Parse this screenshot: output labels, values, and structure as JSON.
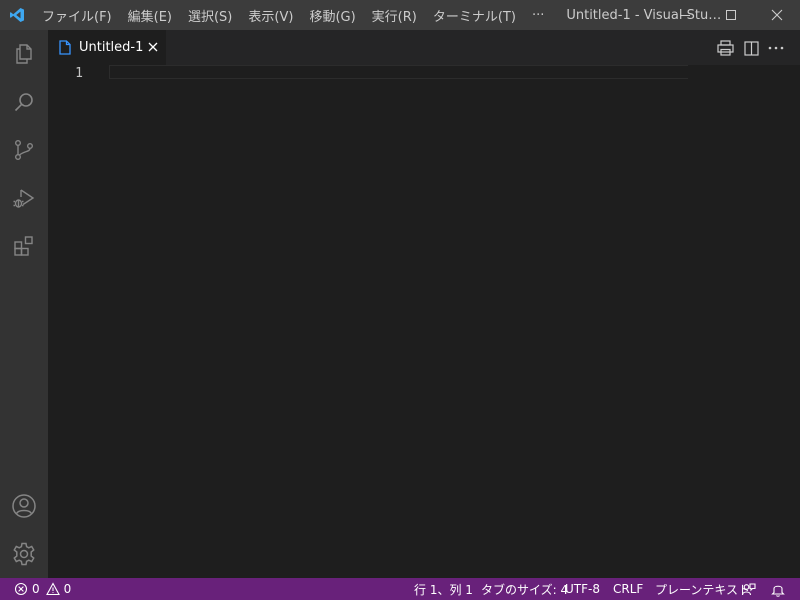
{
  "titlebar": {
    "app_icon": "vscode-logo-icon",
    "menu": [
      "ファイル(F)",
      "編集(E)",
      "選択(S)",
      "表示(V)",
      "移動(G)",
      "実行(R)",
      "ターミナル(T)",
      "···"
    ],
    "window_title": "Untitled-1 - Visual Studio ...",
    "controls": [
      "minimize-icon",
      "maximize-icon",
      "close-icon"
    ]
  },
  "activity_bar": {
    "top": [
      "explorer-icon",
      "search-icon",
      "source-control-icon",
      "run-debug-icon",
      "extensions-icon"
    ],
    "bottom": [
      "account-icon",
      "manage-gear-icon"
    ]
  },
  "tabs": [
    {
      "label": "Untitled-1",
      "icon": "file-icon",
      "active": true
    }
  ],
  "editor_actions": [
    "print-icon",
    "split-editor-icon",
    "more-actions-icon"
  ],
  "editor": {
    "line_numbers": [
      "1"
    ],
    "lines": [
      ""
    ]
  },
  "statusbar": {
    "errors": "0",
    "warnings": "0",
    "position": "行 1、列 1",
    "indent": "タブのサイズ: 4",
    "encoding": "UTF-8",
    "eol": "CRLF",
    "language": "プレーンテキスト",
    "icons": [
      "error-icon",
      "warning-icon",
      "feedback-icon",
      "notifications-bell-icon"
    ]
  },
  "colors": {
    "titlebar": "#3c3c3c",
    "activity_bar": "#333333",
    "tabs_bar": "#252526",
    "editor": "#1e1e1e",
    "statusbar": "#68217a",
    "accent": "#3794ff"
  }
}
